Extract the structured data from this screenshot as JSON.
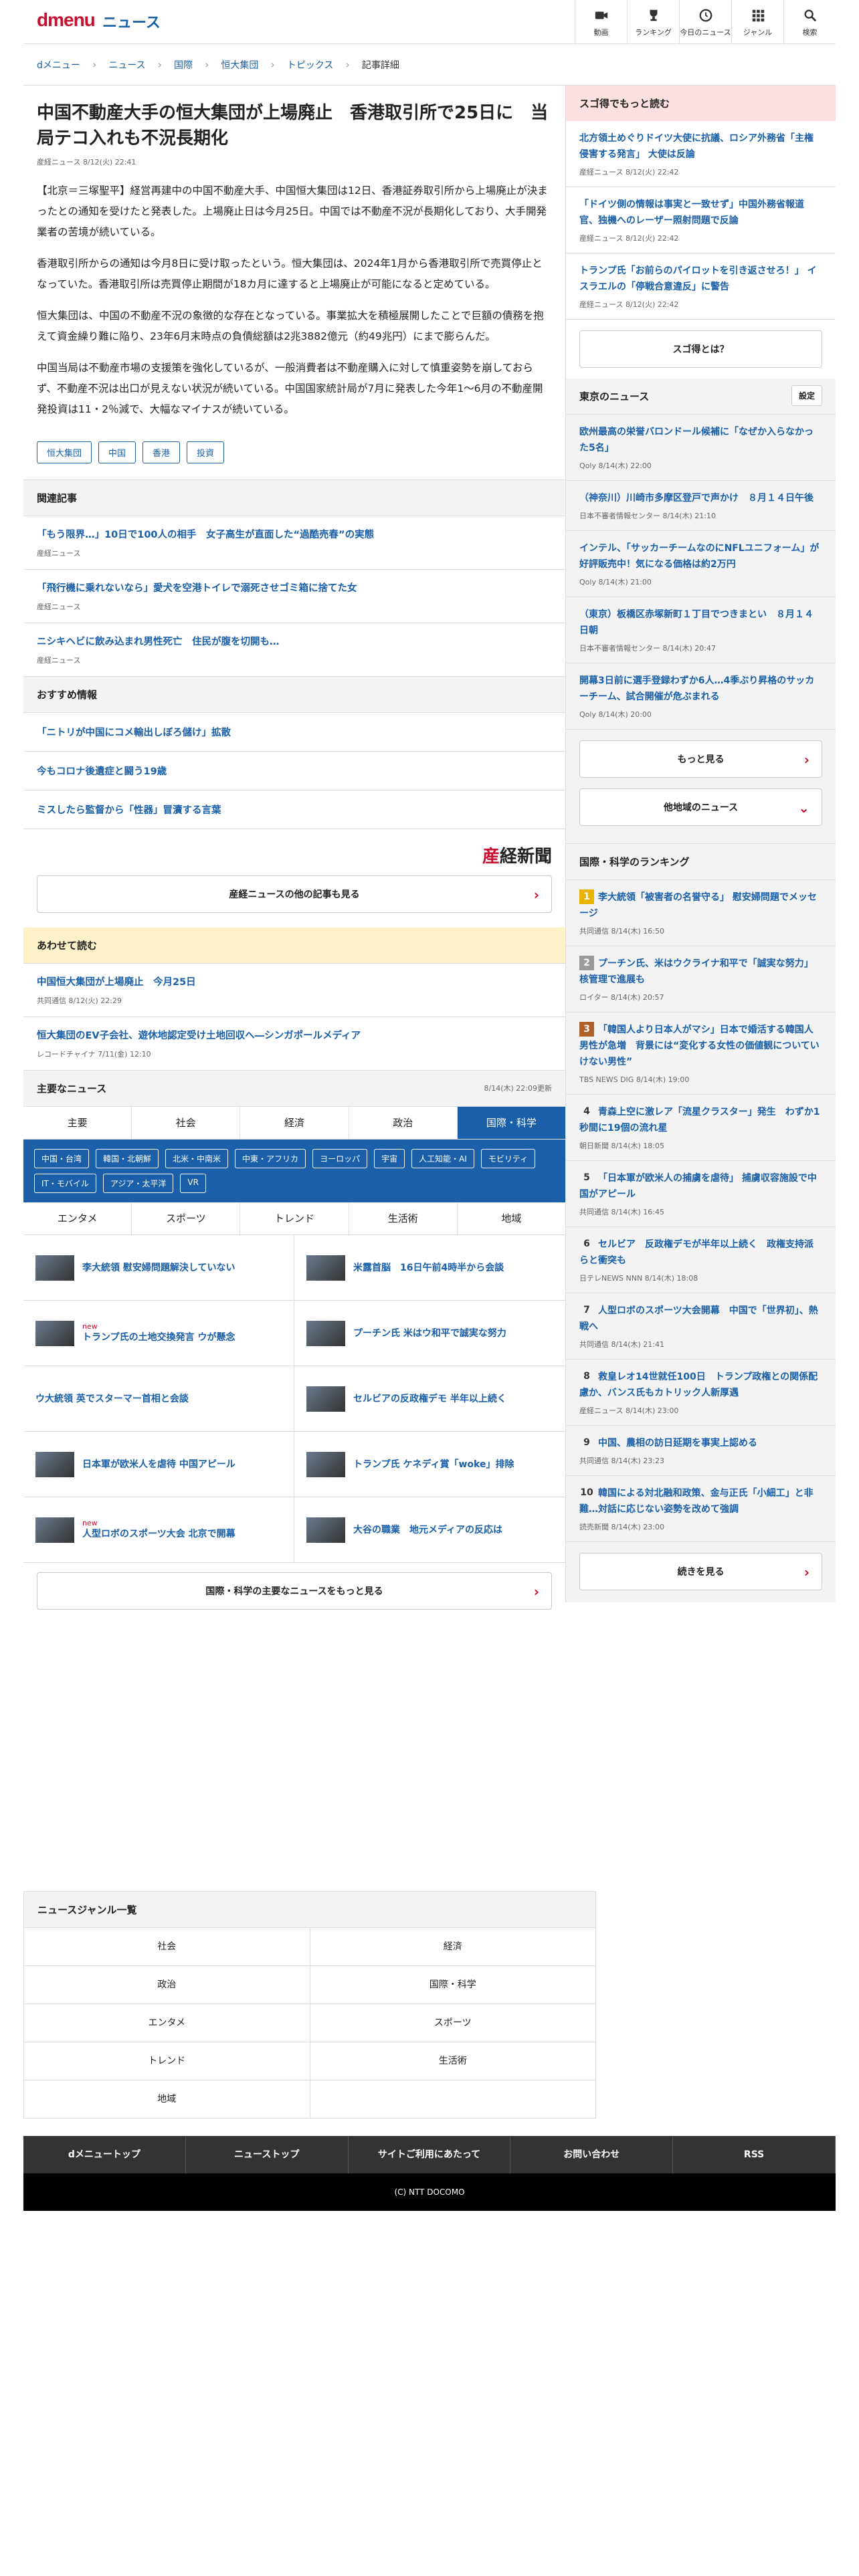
{
  "header": {
    "logo": "dmenu",
    "section": "ニュース",
    "nav": [
      {
        "label": "動画",
        "icon": "video-icon"
      },
      {
        "label": "ランキング",
        "icon": "trophy-icon"
      },
      {
        "label": "今日のニュース",
        "icon": "clock-icon"
      },
      {
        "label": "ジャンル",
        "icon": "grid-icon"
      },
      {
        "label": "検索",
        "icon": "search-icon"
      }
    ]
  },
  "breadcrumb": [
    "dメニュー",
    "ニュース",
    "国際",
    "恒大集団",
    "トピックス",
    "記事詳細"
  ],
  "article": {
    "title": "中国不動産大手の恒大集団が上場廃止　香港取引所で25日に　当局テコ入れも不況長期化",
    "meta": "産経ニュース 8/12(火) 22:41",
    "paragraphs": [
      "【北京＝三塚聖平】経営再建中の中国不動産大手、中国恒大集団は12日、香港証券取引所から上場廃止が決まったとの通知を受けたと発表した。上場廃止日は今月25日。中国では不動産不況が長期化しており、大手開発業者の苦境が続いている。",
      "香港取引所からの通知は今月8日に受け取ったという。恒大集団は、2024年1月から香港取引所で売買停止となっていた。香港取引所は売買停止期間が18カ月に達すると上場廃止が可能になると定めている。",
      "恒大集団は、中国の不動産不況の象徴的な存在となっている。事業拡大を積極展開したことで巨額の債務を抱えて資金繰り難に陥り、23年6月末時点の負債総額は2兆3882億元（約49兆円）にまで膨らんだ。",
      "中国当局は不動産市場の支援策を強化しているが、一般消費者は不動産購入に対して慎重姿勢を崩しておらず、不動産不況は出口が見えない状況が続いている。中国国家統計局が7月に発表した今年1～6月の不動産開発投資は11・2％減で、大幅なマイナスが続いている。"
    ],
    "tags": [
      "恒大集団",
      "中国",
      "香港",
      "投資"
    ]
  },
  "related": {
    "heading": "関連記事",
    "items": [
      {
        "title": "「もう限界…」10日で100人の相手　女子高生が直面した“過酷売春”の実態",
        "src": "産経ニュース"
      },
      {
        "title": "「飛行機に乗れないなら」愛犬を空港トイレで溺死させゴミ箱に捨てた女",
        "src": "産経ニュース"
      },
      {
        "title": "ニシキヘビに飲み込まれ男性死亡　住民が腹を切開も…",
        "src": "産経ニュース"
      }
    ]
  },
  "recommend": {
    "heading": "おすすめ情報",
    "items": [
      "「ニトリが中国にコメ輸出しぼろ儲け」拡散",
      "今もコロナ後遺症と闘う19歳",
      "ミスしたら監督から「性器」冒瀆する言葉"
    ]
  },
  "sankei": {
    "logo_mark": "産",
    "logo": "経新聞",
    "more": "産経ニュースの他の記事も見る"
  },
  "also": {
    "heading": "あわせて読む",
    "items": [
      {
        "title": "中国恒大集団が上場廃止　今月25日",
        "src": "共同通信 8/12(火) 22:29"
      },
      {
        "title": "恒大集団のEV子会社、遊休地認定受け土地回収へ―シンガポールメディア",
        "src": "レコードチャイナ 7/11(金) 12:10"
      }
    ]
  },
  "mainnews": {
    "heading": "主要なニュース",
    "updated": "8/14(木) 22:09更新",
    "tabs": [
      "主要",
      "社会",
      "経済",
      "政治",
      "国際・科学"
    ],
    "active_tab": "国際・科学",
    "subtags": [
      "中国・台湾",
      "韓国・北朝鮮",
      "北米・中南米",
      "中東・アフリカ",
      "ヨーロッパ",
      "宇宙",
      "人工知能・AI",
      "モビリティ",
      "IT・モバイル",
      "アジア・太平洋",
      "VR"
    ],
    "tabs2": [
      "エンタメ",
      "スポーツ",
      "トレンド",
      "生活術",
      "地域"
    ],
    "items": [
      {
        "title": "李大統領 慰安婦問題解決していない",
        "new": ""
      },
      {
        "title": "米露首脳　16日午前4時半から会談",
        "new": ""
      },
      {
        "title": "トランプ氏の土地交換発言 ウが懸念",
        "new": "new"
      },
      {
        "title": "プーチン氏 米はウ和平で誠実な努力",
        "new": ""
      },
      {
        "title": "ウ大統領 英でスターマー首相と会談",
        "new": ""
      },
      {
        "title": "セルビアの反政権デモ 半年以上続く",
        "new": ""
      },
      {
        "title": "日本軍が欧米人を虐待 中国アピール",
        "new": ""
      },
      {
        "title": "トランプ氏 ケネディ賞「woke」排除",
        "new": ""
      },
      {
        "title": "人型ロボのスポーツ大会 北京で開幕",
        "new": "new"
      },
      {
        "title": "大谷の職業　地元メディアの反応は",
        "new": ""
      }
    ],
    "more": "国際・科学の主要なニュースをもっと見る"
  },
  "side_sugo": {
    "heading": "スゴ得でもっと読む",
    "items": [
      {
        "title": "北方領土めぐりドイツ大使に抗議、ロシア外務省「主権侵害する発言」 大使は反論",
        "src": "産経ニュース 8/12(火) 22:42"
      },
      {
        "title": "「ドイツ側の情報は事実と一致せず」中国外務省報道官、独機へのレーザー照射問題で反論",
        "src": "産経ニュース 8/12(火) 22:42"
      },
      {
        "title": "トランプ氏「お前らのパイロットを引き返させろ！」 イスラエルの「停戦合意違反」に警告",
        "src": "産経ニュース 8/12(火) 22:42"
      }
    ],
    "btn": "スゴ得とは？"
  },
  "side_tokyo": {
    "heading": "東京のニュース",
    "setting": "設定",
    "items": [
      {
        "title": "欧州最高の栄誉バロンドール候補に「なぜか入らなかった5名」",
        "src": "Qoly 8/14(木) 22:00"
      },
      {
        "title": "（神奈川）川崎市多摩区登戸で声かけ　８月１４日午後",
        "src": "日本不審者情報センター 8/14(木) 21:10"
      },
      {
        "title": "インテル、「サッカーチームなのにNFLユニフォーム」が好評販売中！気になる価格は約2万円",
        "src": "Qoly 8/14(木) 21:00"
      },
      {
        "title": "（東京）板橋区赤塚新町１丁目でつきまとい　８月１４日朝",
        "src": "日本不審者情報センター 8/14(木) 20:47"
      },
      {
        "title": "開幕3日前に選手登録わずか6人…4季ぶり昇格のサッカーチーム、試合開催が危ぶまれる",
        "src": "Qoly 8/14(木) 20:00"
      }
    ],
    "more": "もっと見る",
    "other": "他地域のニュース"
  },
  "ranking": {
    "heading": "国際・科学のランキング",
    "items": [
      {
        "n": "1",
        "title": "李大統領「被害者の名誉守る」 慰安婦問題でメッセージ",
        "src": "共同通信 8/14(木) 16:50",
        "color": "#e8b400"
      },
      {
        "n": "2",
        "title": "プーチン氏、米はウクライナ和平で「誠実な努力」 核管理で進展も",
        "src": "ロイター 8/14(木) 20:57",
        "color": "#9a9a9a"
      },
      {
        "n": "3",
        "title": "「韓国人より日本人がマシ」日本で婚活する韓国人男性が急増　背景には“変化する女性の価値観についていけない男性”",
        "src": "TBS NEWS DIG 8/14(木) 19:00",
        "color": "#b0602a"
      },
      {
        "n": "4",
        "title": "青森上空に激レア「流星クラスター」発生　わずか1秒間に19個の流れ星",
        "src": "朝日新聞 8/14(木) 18:05",
        "color": "#333"
      },
      {
        "n": "5",
        "title": "「日本軍が欧米人の捕虜を虐待」 捕虜収容施設で中国がアピール",
        "src": "共同通信 8/14(木) 16:45",
        "color": "#333"
      },
      {
        "n": "6",
        "title": "セルビア　反政権デモが半年以上続く　政権支持派らと衝突も",
        "src": "日テレNEWS NNN 8/14(木) 18:08",
        "color": "#333"
      },
      {
        "n": "7",
        "title": "人型ロボのスポーツ大会開幕　中国で「世界初」、熱戦へ",
        "src": "共同通信 8/14(木) 21:41",
        "color": "#333"
      },
      {
        "n": "8",
        "title": "救皇レオ14世就任100日　トランプ政権との関係配慮か、バンス氏もカトリック人新厚遇",
        "src": "産経ニュース 8/14(木) 23:00",
        "color": "#333"
      },
      {
        "n": "9",
        "title": "中国、農相の訪日延期を事実上認める",
        "src": "共同通信 8/14(木) 23:23",
        "color": "#333"
      },
      {
        "n": "10",
        "title": "韓国による対北融和政策、金与正氏「小細工」と非難…対話に応じない姿勢を改めて強調",
        "src": "読売新聞 8/14(木) 23:00",
        "color": "#333"
      }
    ],
    "more": "続きを見る"
  },
  "genre": {
    "heading": "ニュースジャンル一覧",
    "rows": [
      [
        "社会",
        "経済"
      ],
      [
        "政治",
        "国際・科学"
      ],
      [
        "エンタメ",
        "スポーツ"
      ],
      [
        "トレンド",
        "生活術"
      ],
      [
        "地域",
        ""
      ]
    ]
  },
  "footer": {
    "links": [
      "dメニュートップ",
      "ニューストップ",
      "サイトご利用にあたって",
      "お問い合わせ",
      "RSS"
    ],
    "copyright": "(C) NTT DOCOMO"
  }
}
